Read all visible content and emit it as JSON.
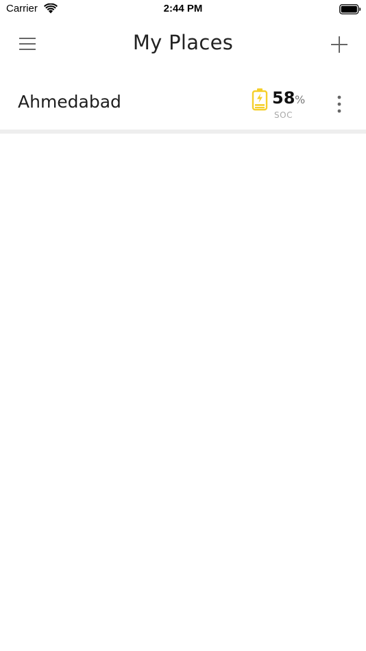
{
  "status_bar": {
    "carrier": "Carrier",
    "time": "2:44 PM",
    "icons": [
      "wifi-icon",
      "battery-icon"
    ]
  },
  "header": {
    "title": "My Places",
    "menu_icon": "hamburger-menu-icon",
    "add_icon": "plus-icon"
  },
  "places": [
    {
      "name": "Ahmedabad",
      "soc_value": "58",
      "soc_unit": "%",
      "soc_label": "SOC",
      "soc_icon": "charging-battery-icon",
      "menu_icon": "more-vertical-icon"
    }
  ],
  "colors": {
    "accent": "#F5CF2A",
    "text_primary": "#1e1e1e",
    "text_muted": "#a8a8a8",
    "divider": "#eeeeee"
  }
}
